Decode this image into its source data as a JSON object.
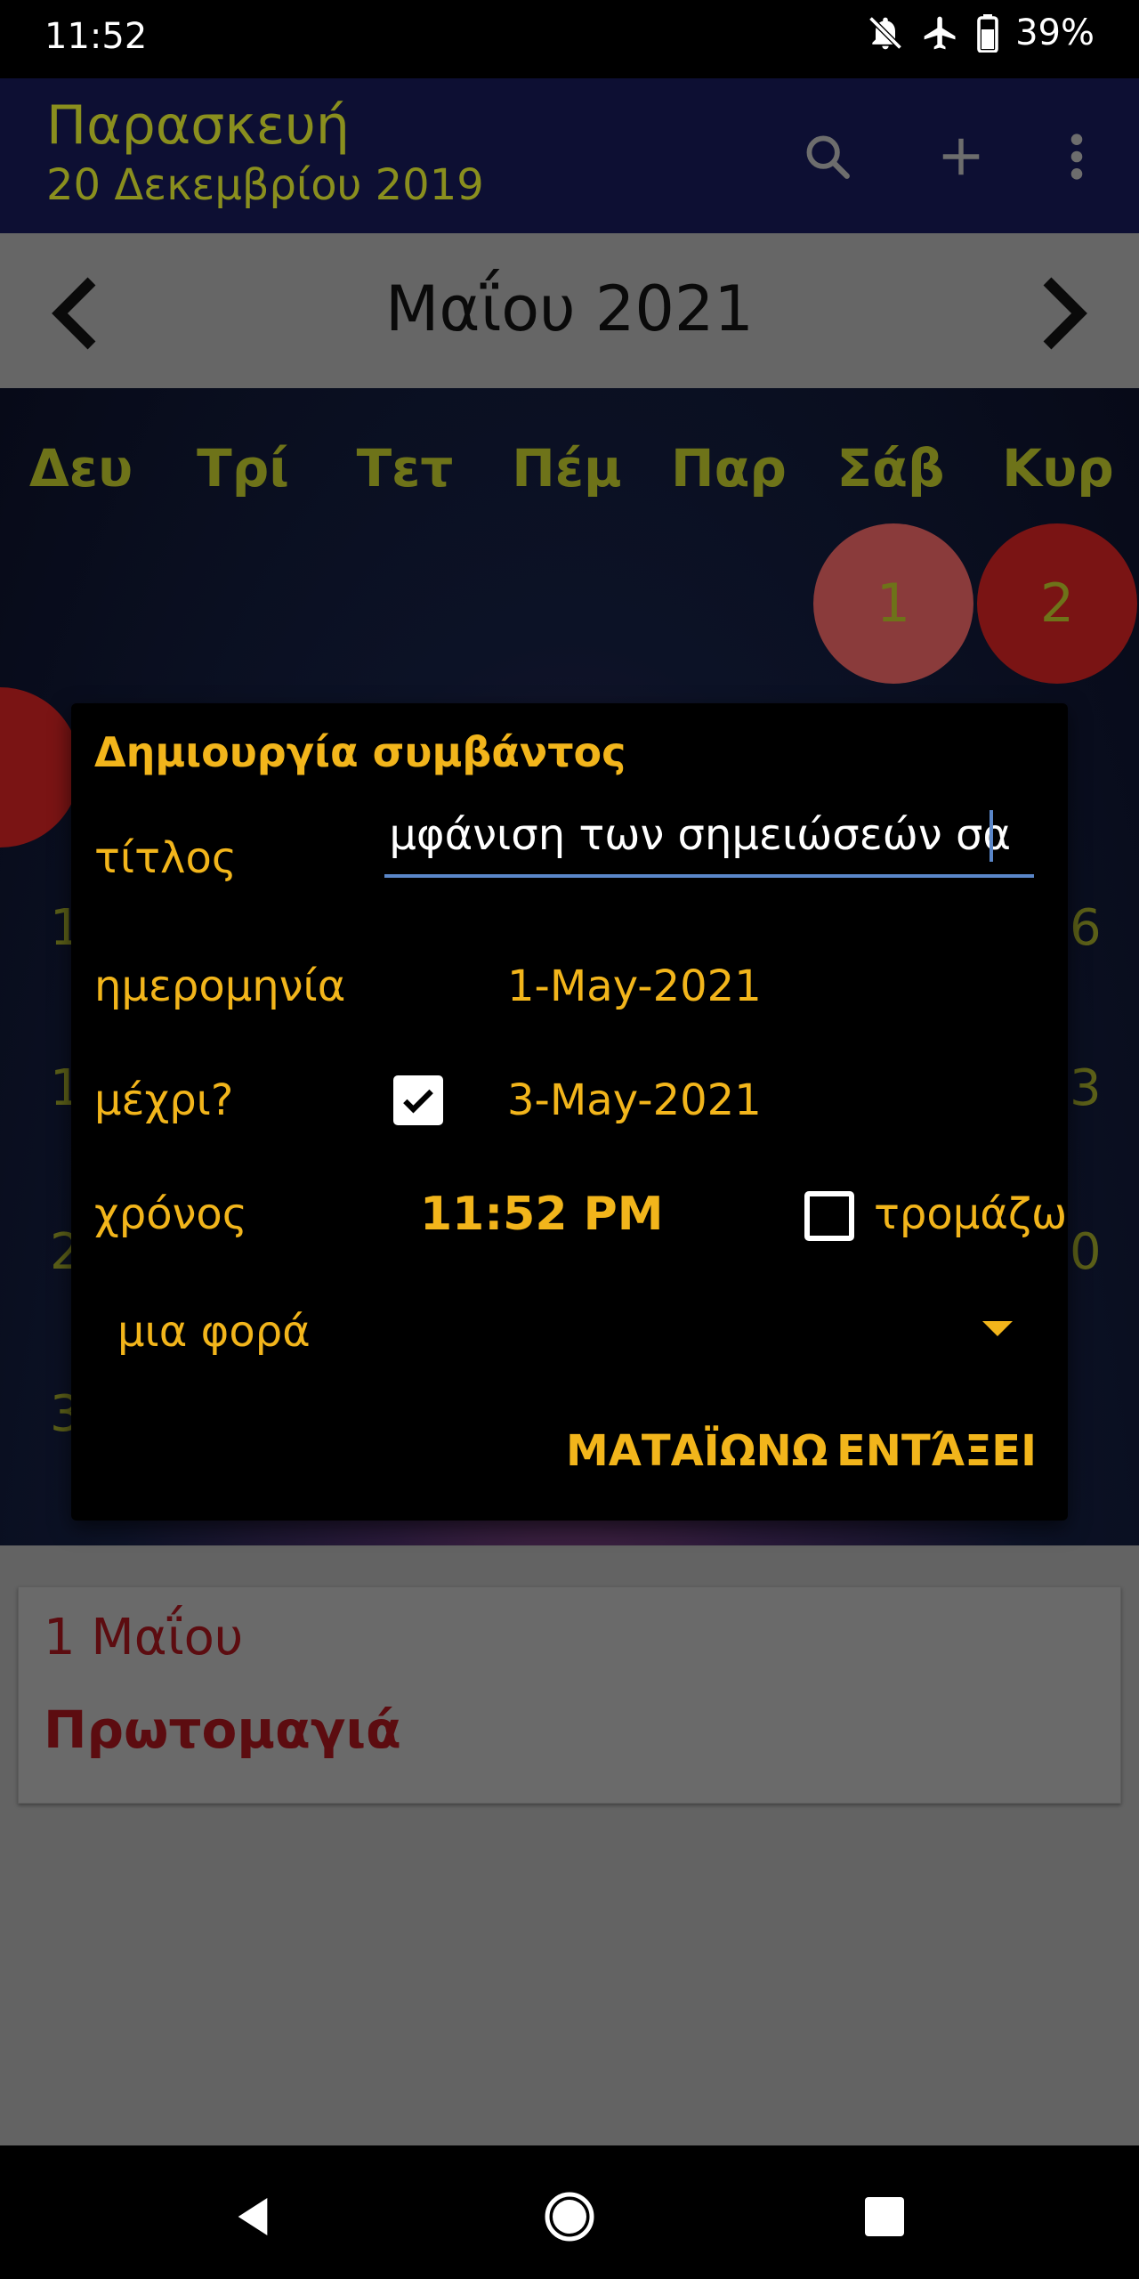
{
  "status_bar": {
    "time": "11:52",
    "battery": "39%"
  },
  "app_bar": {
    "title": "Παρασκευή",
    "subtitle": "20 Δεκεμβρίου 2019",
    "actions": [
      "search-icon",
      "add-icon",
      "more-vert-icon"
    ]
  },
  "month_nav": {
    "label": "Μαΐου 2021"
  },
  "calendar": {
    "weekdays": [
      "Δευ",
      "Τρί",
      "Τετ",
      "Πέμ",
      "Παρ",
      "Σάβ",
      "Κυρ"
    ],
    "visible_days": [
      "1",
      "2"
    ],
    "left_edge_digits": [
      "1",
      "1",
      "2",
      "3"
    ],
    "right_edge_digits": [
      "6",
      "3",
      "0"
    ],
    "colors": {
      "saturday_circle": "#8a3b3b",
      "sunday_circle": "#7a1414"
    }
  },
  "dialog": {
    "title": "Δημιουργία συμβάντος",
    "title_label": "τίτλος",
    "title_value": ":μφάνιση των σημειώσεών σα",
    "date_label": "ημερομηνία",
    "date_value": "1-Μay-2021",
    "until_label": "μέχρι?",
    "until_checked": true,
    "until_value": "3-Μay-2021",
    "time_label": "χρόνος",
    "time_value": "11:52 PM",
    "alarm_label": "τρομάζω",
    "alarm_checked": false,
    "repeat_value": "μια φορά",
    "cancel_label": "ΜΑΤΑΪΩΝΩ",
    "ok_label": "ΕΝΤΆΞΕΙ",
    "accent_color": "#f2b51b"
  },
  "event_card": {
    "date": "1 Μαΐου",
    "title": "Πρωτομαγιά",
    "color": "#5c0c10"
  },
  "nav_bar": {
    "buttons": [
      "back-icon",
      "home-icon",
      "recents-icon"
    ]
  }
}
